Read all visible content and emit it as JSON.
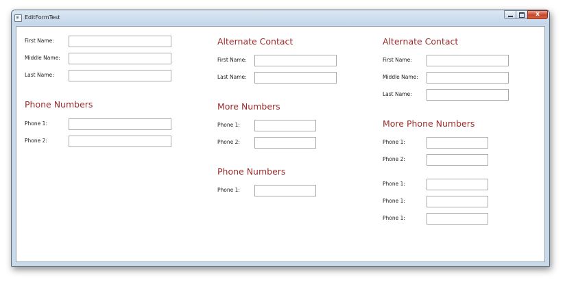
{
  "window": {
    "title": "EditFormTest",
    "close_glyph": "x",
    "icon": "app-icon"
  },
  "col1": {
    "first_name_label": "First Name:",
    "middle_name_label": "Middle Name:",
    "last_name_label": "Last Name:",
    "phone_heading": "Phone Numbers",
    "phone1_label": "Phone 1:",
    "phone2_label": "Phone 2:",
    "first_name_value": "",
    "middle_name_value": "",
    "last_name_value": "",
    "phone1_value": "",
    "phone2_value": ""
  },
  "col2": {
    "alt_heading": "Alternate Contact",
    "first_name_label": "First Name:",
    "last_name_label": "Last Name:",
    "more_heading": "More Numbers",
    "more_phone1_label": "Phone 1:",
    "more_phone2_label": "Phone 2:",
    "phone_heading": "Phone Numbers",
    "phone1_label": "Phone 1:",
    "first_name_value": "",
    "last_name_value": "",
    "more_phone1_value": "",
    "more_phone2_value": "",
    "phone1_value": ""
  },
  "col3": {
    "alt_heading": "Alternate Contact",
    "first_name_label": "First Name:",
    "middle_name_label": "Middle Name:",
    "last_name_label": "Last Name:",
    "more_heading": "More Phone Numbers",
    "phone1_label": "Phone 1:",
    "phone2_label": "Phone 2:",
    "phone3_label": "Phone 1:",
    "phone4_label": "Phone 1:",
    "phone5_label": "Phone 1:",
    "first_name_value": "",
    "middle_name_value": "",
    "last_name_value": "",
    "phone1_value": "",
    "phone2_value": "",
    "phone3_value": "",
    "phone4_value": "",
    "phone5_value": ""
  },
  "colors": {
    "heading": "#9b2a2a",
    "close_button": "#c8452a"
  }
}
